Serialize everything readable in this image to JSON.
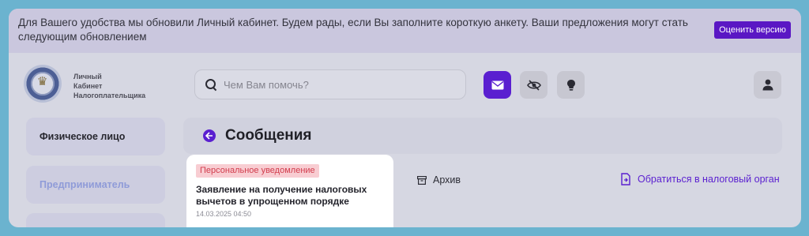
{
  "banner": {
    "text": "Для Вашего удобства мы обновили Личный кабинет. Будем рады, если Вы заполните короткую анкету. Ваши предложения могут стать следующим обновлением",
    "button_label": "Оценить версию"
  },
  "header": {
    "brand_line1": "Личный",
    "brand_line2": "Кабинет",
    "brand_line3": "Налогоплательщика",
    "search_placeholder": "Чем Вам помочь?",
    "icons": [
      "mail-icon",
      "eye-off-icon",
      "lightbulb-icon",
      "user-icon"
    ]
  },
  "sidebar": {
    "items": [
      {
        "label": "Физическое лицо"
      },
      {
        "label": "Предприниматель"
      },
      {
        "label": ""
      }
    ]
  },
  "main": {
    "title": "Сообщения",
    "message": {
      "badge": "Персональное уведомление",
      "title": "Заявление на получение налоговых вычетов в упрощенном порядке",
      "date": "14.03.2025 04:50"
    },
    "archive_label": "Архив",
    "contact_label": "Обратиться в налоговый орган"
  },
  "colors": {
    "accent": "#5a1fd0",
    "badge_bg": "#f8cdd2",
    "badge_text": "#d23d4d",
    "frame_bg": "#d6d7e2",
    "outer_bg": "#6bb3cf"
  }
}
